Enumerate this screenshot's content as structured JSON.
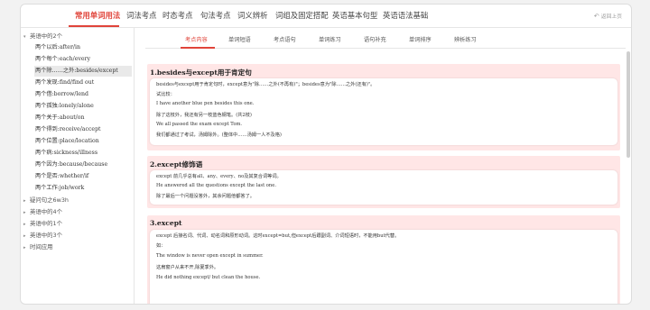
{
  "topnav": {
    "items": [
      "常用单词用法",
      "词法考点",
      "时态考点",
      "句法考点",
      "词义辨析",
      "词组及固定搭配",
      "英语基本句型",
      "英语语法基础"
    ],
    "back": "返回上页"
  },
  "sidebar": {
    "groups": [
      {
        "label": "英语中的2个",
        "expanded": true,
        "children": [
          "两个以后:after/in",
          "两个每个:each/every",
          "两个除……之外:besides/except",
          "两个发现:find/find out",
          "两个借:borrow/lend",
          "两个孤独:lonely/alone",
          "两个关于:about/on",
          "两个得到:receive/accept",
          "两个位置:place/location",
          "两个病:sickness/illness",
          "两个因为:because/because",
          "两个是否:whether/if",
          "两个工作:job/work"
        ]
      },
      {
        "label": "疑问句之6w3h",
        "expanded": false
      },
      {
        "label": "英语中的4个",
        "expanded": false
      },
      {
        "label": "英语中的1个",
        "expanded": false
      },
      {
        "label": "英语中的3个",
        "expanded": false
      },
      {
        "label": "时间应用",
        "expanded": false
      }
    ]
  },
  "subtabs": [
    "考点内容",
    "单词短语",
    "考点语句",
    "单词练习",
    "语句补充",
    "单词排序",
    "辨析练习"
  ],
  "sections": [
    {
      "title": "1.besides与except用于肯定句",
      "lines": [
        "besides与except用于肯定句时，except意为\"除……之外(不再有)\"；besides意为\"除……之外(还有)\"。",
        "试比较：",
        "I have another blue pen besides this one.",
        "除了这枝外，我还有另一枝蓝色钢笔。(共2枝)",
        "We all passed the exam except Tom.",
        "我们都通过了考试，汤姆除外。(整体中……汤姆一人不及格)"
      ]
    },
    {
      "title": "2.except修饰语",
      "lines": [
        "except 前几乎总有all、any、every、no及其复合词等词。",
        "He answered all the questions except the last one.",
        "除了最后一个问题没答外，其余问题他都答了。"
      ]
    },
    {
      "title": "3.except",
      "lines": [
        "except 后接名词、代词、动名词和原形动词。这时except=but,但except后跟副词、介词短语时，不能用but代替。",
        "如：",
        "The window is never open except in summer.",
        "这扇窗户从来不开,除夏季外。",
        "He did nothing except/ but clean the house."
      ]
    }
  ],
  "colors": {
    "accent": "#e0443a",
    "section_bg": "#ffe6e6"
  }
}
